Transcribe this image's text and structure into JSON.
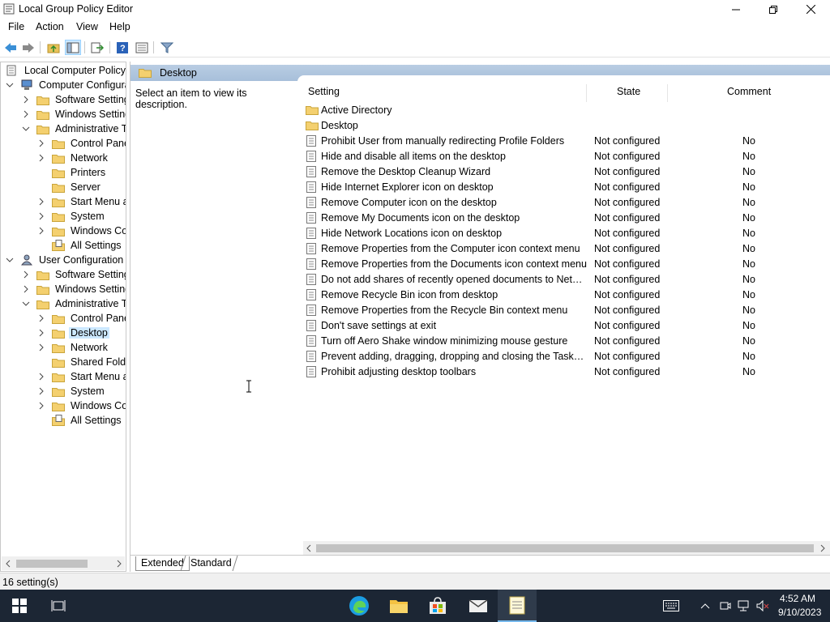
{
  "window": {
    "title": "Local Group Policy Editor",
    "controls": [
      "minimize-icon",
      "restore-icon",
      "close-icon"
    ]
  },
  "menu": [
    "File",
    "Action",
    "View",
    "Help"
  ],
  "toolbar": [
    "back-icon",
    "forward-icon",
    "up-folder-icon",
    "show-hide-tree-icon",
    "export-list-icon",
    "help-icon",
    "properties-icon",
    "filter-icon"
  ],
  "tree": {
    "root": "Local Computer Policy",
    "computer": {
      "label": "Computer Configura",
      "software": "Software Settings",
      "windows": "Windows Setting",
      "admin": "Administrative Te",
      "admin_children": [
        "Control Panel",
        "Network",
        "Printers",
        "Server",
        "Start Menu ar",
        "System",
        "Windows Cor",
        "All Settings"
      ]
    },
    "user": {
      "label": "User Configuration",
      "software": "Software Settings",
      "windows": "Windows Setting",
      "admin": "Administrative Te",
      "admin_children": [
        "Control Panel",
        "Desktop",
        "Network",
        "Shared Folder",
        "Start Menu ar",
        "System",
        "Windows Cor",
        "All Settings"
      ]
    }
  },
  "content": {
    "header": "Desktop",
    "description": "Select an item to view its description.",
    "columns": {
      "setting": "Setting",
      "state": "State",
      "comment": "Comment"
    },
    "folders": [
      "Active Directory",
      "Desktop"
    ],
    "rows": [
      {
        "name": "Prohibit User from manually redirecting Profile Folders",
        "state": "Not configured",
        "comment": "No"
      },
      {
        "name": "Hide and disable all items on the desktop",
        "state": "Not configured",
        "comment": "No"
      },
      {
        "name": "Remove the Desktop Cleanup Wizard",
        "state": "Not configured",
        "comment": "No"
      },
      {
        "name": "Hide Internet Explorer icon on desktop",
        "state": "Not configured",
        "comment": "No"
      },
      {
        "name": "Remove Computer icon on the desktop",
        "state": "Not configured",
        "comment": "No"
      },
      {
        "name": "Remove My Documents icon on the desktop",
        "state": "Not configured",
        "comment": "No"
      },
      {
        "name": "Hide Network Locations icon on desktop",
        "state": "Not configured",
        "comment": "No"
      },
      {
        "name": "Remove Properties from the Computer icon context menu",
        "state": "Not configured",
        "comment": "No"
      },
      {
        "name": "Remove Properties from the Documents icon context menu",
        "state": "Not configured",
        "comment": "No"
      },
      {
        "name": "Do not add shares of recently opened documents to Networ...",
        "state": "Not configured",
        "comment": "No"
      },
      {
        "name": "Remove Recycle Bin icon from desktop",
        "state": "Not configured",
        "comment": "No"
      },
      {
        "name": "Remove Properties from the Recycle Bin context menu",
        "state": "Not configured",
        "comment": "No"
      },
      {
        "name": "Don't save settings at exit",
        "state": "Not configured",
        "comment": "No"
      },
      {
        "name": "Turn off Aero Shake window minimizing mouse gesture",
        "state": "Not configured",
        "comment": "No"
      },
      {
        "name": "Prevent adding, dragging, dropping and closing the Taskbar...",
        "state": "Not configured",
        "comment": "No"
      },
      {
        "name": "Prohibit adjusting desktop toolbars",
        "state": "Not configured",
        "comment": "No"
      }
    ],
    "tabs": {
      "extended": "Extended",
      "standard": "Standard"
    }
  },
  "status": "16 setting(s)",
  "taskbar": {
    "apps": [
      "start-icon",
      "task-view-icon",
      "edge-icon",
      "file-explorer-icon",
      "store-icon",
      "mail-icon",
      "notepad-icon"
    ],
    "time": "4:52 AM",
    "date": "9/10/2023"
  },
  "colors": {
    "header": "#b9cde3",
    "selection": "#cce8ff",
    "taskbar": "#1c2634",
    "folder": "#e8c25a"
  }
}
